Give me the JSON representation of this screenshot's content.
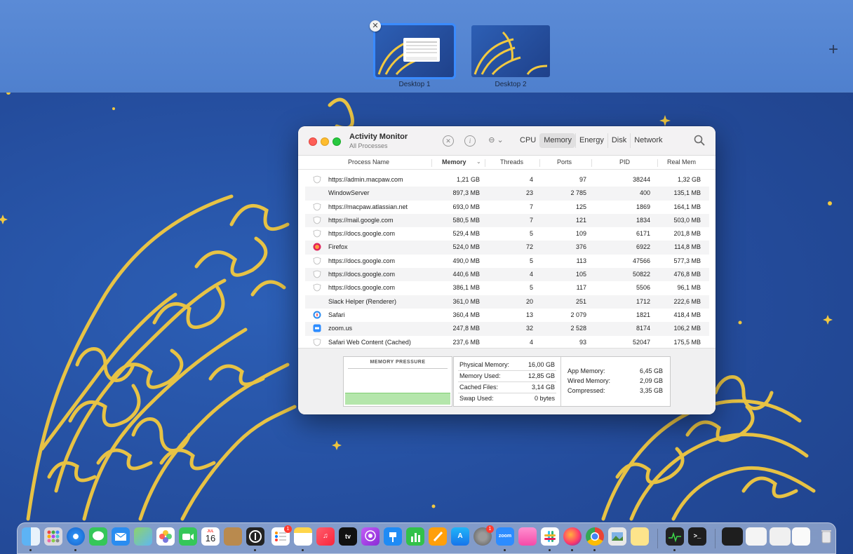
{
  "spaces": {
    "items": [
      {
        "label": "Desktop 1"
      },
      {
        "label": "Desktop 2"
      }
    ],
    "close_glyph": "✕",
    "add_glyph": "+"
  },
  "window": {
    "title": "Activity Monitor",
    "subtitle": "All Processes",
    "options_glyph": "⊖ ⌄",
    "info_glyph": "i",
    "stop_glyph": "✕",
    "tabs": [
      "CPU",
      "Memory",
      "Energy",
      "Disk",
      "Network"
    ],
    "selected_tab": "Memory"
  },
  "table": {
    "columns": [
      "Process Name",
      "Memory",
      "Threads",
      "Ports",
      "PID",
      "Real Mem"
    ],
    "sorted_column": "Memory",
    "rows": [
      {
        "icon": "shield-icon",
        "name": "https://admin.macpaw.com",
        "memory": "1,21 GB",
        "threads": "4",
        "ports": "97",
        "pid": "38244",
        "real_mem": "1,32 GB"
      },
      {
        "icon": "none",
        "name": "WindowServer",
        "memory": "897,3 MB",
        "threads": "23",
        "ports": "2 785",
        "pid": "400",
        "real_mem": "135,1 MB"
      },
      {
        "icon": "shield-icon",
        "name": "https://macpaw.atlassian.net",
        "memory": "693,0 MB",
        "threads": "7",
        "ports": "125",
        "pid": "1869",
        "real_mem": "164,1 MB"
      },
      {
        "icon": "shield-icon",
        "name": "https://mail.google.com",
        "memory": "580,5 MB",
        "threads": "7",
        "ports": "121",
        "pid": "1834",
        "real_mem": "503,0 MB"
      },
      {
        "icon": "shield-icon",
        "name": "https://docs.google.com",
        "memory": "529,4 MB",
        "threads": "5",
        "ports": "109",
        "pid": "6171",
        "real_mem": "201,8 MB"
      },
      {
        "icon": "firefox-icon",
        "name": "Firefox",
        "memory": "524,0 MB",
        "threads": "72",
        "ports": "376",
        "pid": "6922",
        "real_mem": "114,8 MB"
      },
      {
        "icon": "shield-icon",
        "name": "https://docs.google.com",
        "memory": "490,0 MB",
        "threads": "5",
        "ports": "113",
        "pid": "47566",
        "real_mem": "577,3 MB"
      },
      {
        "icon": "shield-icon",
        "name": "https://docs.google.com",
        "memory": "440,6 MB",
        "threads": "4",
        "ports": "105",
        "pid": "50822",
        "real_mem": "476,8 MB"
      },
      {
        "icon": "shield-icon",
        "name": "https://docs.google.com",
        "memory": "386,1 MB",
        "threads": "5",
        "ports": "117",
        "pid": "5506",
        "real_mem": "96,1 MB"
      },
      {
        "icon": "none",
        "name": "Slack Helper (Renderer)",
        "memory": "361,0 MB",
        "threads": "20",
        "ports": "251",
        "pid": "1712",
        "real_mem": "222,6 MB"
      },
      {
        "icon": "safari-icon",
        "name": "Safari",
        "memory": "360,4 MB",
        "threads": "13",
        "ports": "2 079",
        "pid": "1821",
        "real_mem": "418,4 MB"
      },
      {
        "icon": "zoom-icon",
        "name": "zoom.us",
        "memory": "247,8 MB",
        "threads": "32",
        "ports": "2 528",
        "pid": "8174",
        "real_mem": "106,2 MB"
      },
      {
        "icon": "shield-icon",
        "name": "Safari Web Content (Cached)",
        "memory": "237,6 MB",
        "threads": "4",
        "ports": "93",
        "pid": "52047",
        "real_mem": "175,5 MB"
      }
    ]
  },
  "memory_panel": {
    "pressure_label": "MEMORY PRESSURE",
    "pressure_level": 0.25,
    "stats_left": [
      {
        "label": "Physical Memory:",
        "value": "16,00 GB"
      },
      {
        "label": "Memory Used:",
        "value": "12,85 GB"
      },
      {
        "label": "Cached Files:",
        "value": "3,14 GB"
      },
      {
        "label": "Swap Used:",
        "value": "0 bytes"
      }
    ],
    "stats_right": [
      {
        "label": "App Memory:",
        "value": "6,45 GB"
      },
      {
        "label": "Wired Memory:",
        "value": "2,09 GB"
      },
      {
        "label": "Compressed:",
        "value": "3,35 GB"
      }
    ]
  },
  "dock": {
    "calendar_day": "16",
    "calendar_month": "JUL",
    "reminders_badge": "1",
    "settings_badge": "1",
    "zoom_label": "zoom",
    "tv_label": "tv"
  },
  "colors": {
    "accent": "#3a8bff",
    "wallpaper_art": "#f2c940",
    "pressure_green": "#b4e6ab"
  }
}
